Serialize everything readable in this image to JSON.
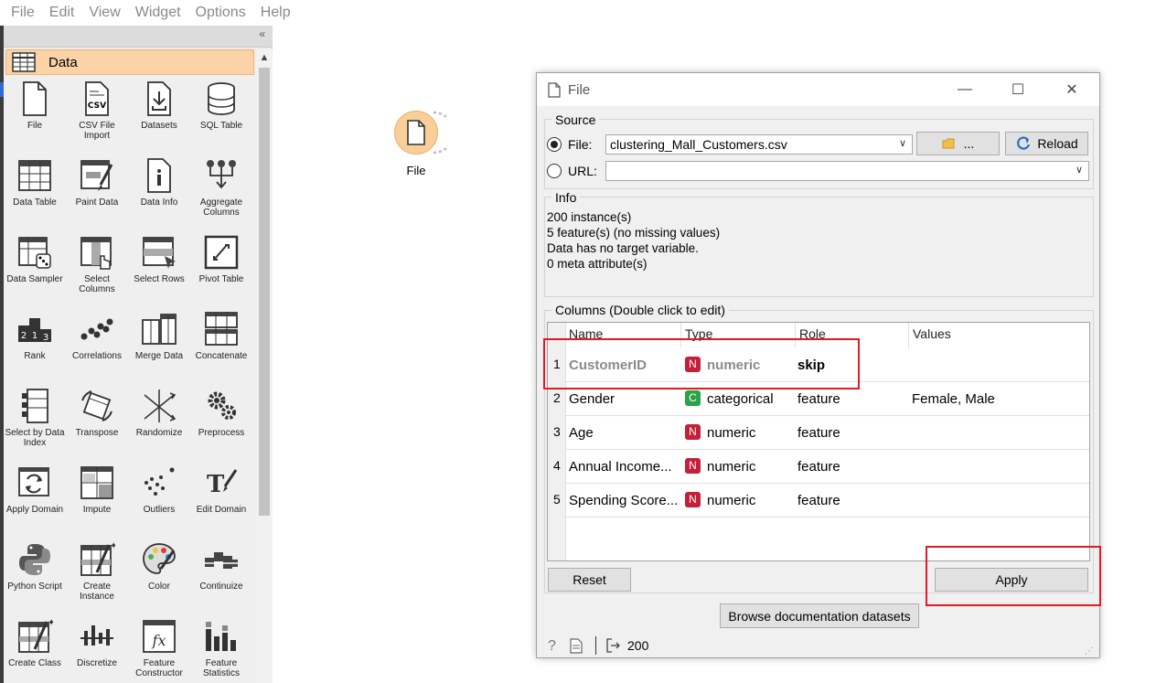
{
  "menu": [
    "File",
    "Edit",
    "View",
    "Widget",
    "Options",
    "Help"
  ],
  "toolbox": {
    "collapse_label": "«",
    "category": "Data",
    "widgets": [
      {
        "label": "File",
        "icon": "file-icon"
      },
      {
        "label": "CSV File Import",
        "icon": "csv-icon"
      },
      {
        "label": "Datasets",
        "icon": "datasets-icon"
      },
      {
        "label": "SQL Table",
        "icon": "database-icon"
      },
      {
        "label": "Data Table",
        "icon": "table-icon"
      },
      {
        "label": "Paint Data",
        "icon": "paint-icon"
      },
      {
        "label": "Data Info",
        "icon": "info-icon"
      },
      {
        "label": "Aggregate Columns",
        "icon": "aggregate-icon"
      },
      {
        "label": "Data Sampler",
        "icon": "sampler-icon"
      },
      {
        "label": "Select Columns",
        "icon": "select-columns-icon"
      },
      {
        "label": "Select Rows",
        "icon": "select-rows-icon"
      },
      {
        "label": "Pivot Table",
        "icon": "pivot-icon"
      },
      {
        "label": "Rank",
        "icon": "rank-icon"
      },
      {
        "label": "Correlations",
        "icon": "correlations-icon"
      },
      {
        "label": "Merge Data",
        "icon": "merge-icon"
      },
      {
        "label": "Concatenate",
        "icon": "concatenate-icon"
      },
      {
        "label": "Select by Data Index",
        "icon": "select-index-icon"
      },
      {
        "label": "Transpose",
        "icon": "transpose-icon"
      },
      {
        "label": "Randomize",
        "icon": "randomize-icon"
      },
      {
        "label": "Preprocess",
        "icon": "gears-icon"
      },
      {
        "label": "Apply Domain",
        "icon": "apply-domain-icon"
      },
      {
        "label": "Impute",
        "icon": "impute-icon"
      },
      {
        "label": "Outliers",
        "icon": "outliers-icon"
      },
      {
        "label": "Edit Domain",
        "icon": "edit-domain-icon"
      },
      {
        "label": "Python Script",
        "icon": "python-icon"
      },
      {
        "label": "Create Instance",
        "icon": "create-instance-icon"
      },
      {
        "label": "Color",
        "icon": "palette-icon"
      },
      {
        "label": "Continuize",
        "icon": "continuize-icon"
      },
      {
        "label": "Create Class",
        "icon": "create-class-icon"
      },
      {
        "label": "Discretize",
        "icon": "discretize-icon"
      },
      {
        "label": "Feature Constructor",
        "icon": "feature-constructor-icon"
      },
      {
        "label": "Feature Statistics",
        "icon": "feature-statistics-icon"
      }
    ]
  },
  "canvas": {
    "node_label": "File"
  },
  "dialog": {
    "title": "File",
    "source": {
      "title": "Source",
      "file_label": "File:",
      "file_value": "clustering_Mall_Customers.csv",
      "browse_label": "...",
      "reload_label": "Reload",
      "url_label": "URL:",
      "url_value": ""
    },
    "info": {
      "title": "Info",
      "lines": [
        "200 instance(s)",
        "5 feature(s) (no missing values)",
        "Data has no target variable.",
        "0 meta attribute(s)"
      ]
    },
    "columns": {
      "title": "Columns (Double click to edit)",
      "headers": [
        "Name",
        "Type",
        "Role",
        "Values"
      ],
      "rows": [
        {
          "num": "1",
          "name": "CustomerID",
          "badge": "N",
          "type": "numeric",
          "role": "skip",
          "values": ""
        },
        {
          "num": "2",
          "name": "Gender",
          "badge": "C",
          "type": "categorical",
          "role": "feature",
          "values": "Female, Male"
        },
        {
          "num": "3",
          "name": "Age",
          "badge": "N",
          "type": "numeric",
          "role": "feature",
          "values": ""
        },
        {
          "num": "4",
          "name": "Annual Income...",
          "badge": "N",
          "type": "numeric",
          "role": "feature",
          "values": ""
        },
        {
          "num": "5",
          "name": "Spending Score...",
          "badge": "N",
          "type": "numeric",
          "role": "feature",
          "values": ""
        }
      ]
    },
    "reset_label": "Reset",
    "apply_label": "Apply",
    "browse_docs_label": "Browse documentation datasets",
    "status_output": "200"
  },
  "colors": {
    "category_bg": "#fbd3a7",
    "numeric_badge": "#c4203a",
    "categorical_badge": "#2aa34a",
    "highlight": "#e01b24"
  }
}
